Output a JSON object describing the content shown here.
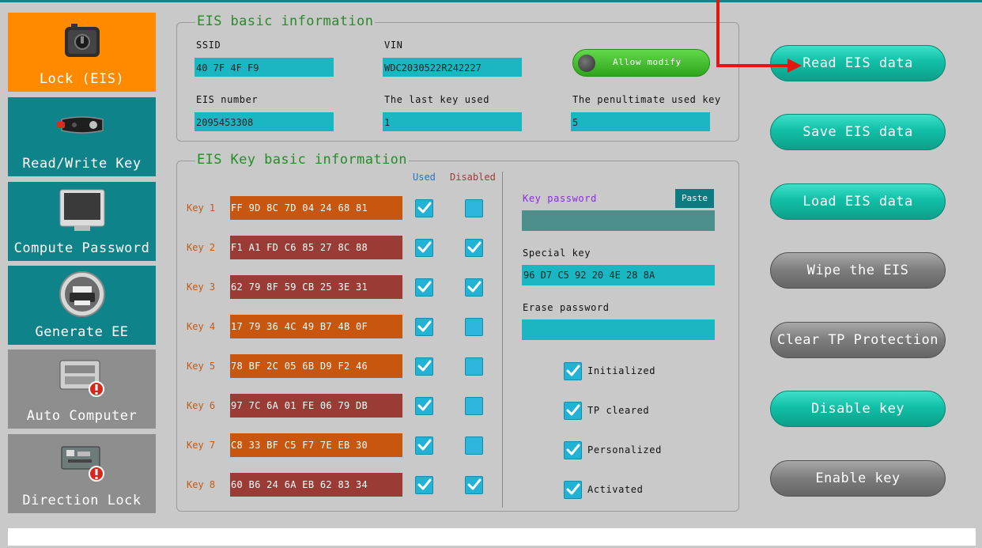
{
  "sidebar": {
    "items": [
      {
        "label": "Lock (EIS)",
        "icon": "lock-device-icon"
      },
      {
        "label": "Read/Write Key",
        "icon": "car-key-icon"
      },
      {
        "label": "Compute Password",
        "icon": "computer-monitor-icon"
      },
      {
        "label": "Generate EE",
        "icon": "printer-icon"
      },
      {
        "label": "Auto Computer",
        "icon": "ecu-warning-icon"
      },
      {
        "label": "Direction Lock",
        "icon": "circuit-board-warning-icon"
      }
    ]
  },
  "eis_basic": {
    "title": "EIS basic information",
    "ssid_label": "SSID",
    "ssid_value": "40 7F 4F F9",
    "vin_label": "VIN",
    "vin_value": "WDC2030522R242227",
    "allow_modify": "Allow modify",
    "eis_number_label": "EIS number",
    "eis_number_value": "2095453308",
    "last_key_label": "The last key used",
    "last_key_value": "1",
    "penultimate_label": "The penultimate used key",
    "penultimate_value": "5"
  },
  "eis_keys": {
    "title": "EIS Key basic information",
    "used_header": "Used",
    "disabled_header": "Disabled",
    "keys": [
      {
        "label": "Key 1",
        "value": "FF 9D 8C 7D 04 24 68 81",
        "used": true,
        "disabled": false
      },
      {
        "label": "Key 2",
        "value": "F1 A1 FD C6 85 27 8C 88",
        "used": true,
        "disabled": true
      },
      {
        "label": "Key 3",
        "value": "62 79 8F 59 CB 25 3E 31",
        "used": true,
        "disabled": true
      },
      {
        "label": "Key 4",
        "value": "17 79 36 4C 49 B7 4B 0F",
        "used": true,
        "disabled": false
      },
      {
        "label": "Key 5",
        "value": "78 BF 2C 05 6B D9 F2 46",
        "used": true,
        "disabled": false
      },
      {
        "label": "Key 6",
        "value": "97 7C 6A 01 FE 06 79 DB",
        "used": true,
        "disabled": false
      },
      {
        "label": "Key 7",
        "value": "C8 33 BF C5 F7 7E EB 30",
        "used": true,
        "disabled": false
      },
      {
        "label": "Key 8",
        "value": "60 B6 24 6A EB 62 83 34",
        "used": true,
        "disabled": true
      }
    ],
    "key_password_label": "Key password",
    "paste_label": "Paste",
    "special_key_label": "Special key",
    "special_key_value": "96 D7 C5 92 20 4E 28 8A",
    "erase_password_label": "Erase password",
    "status": [
      {
        "label": "Initialized",
        "checked": true
      },
      {
        "label": "TP cleared",
        "checked": true
      },
      {
        "label": "Personalized",
        "checked": true
      },
      {
        "label": "Activated",
        "checked": true
      }
    ]
  },
  "actions": {
    "read": "Read  EIS data",
    "save": "Save EIS data",
    "load": "Load EIS data",
    "wipe": "Wipe the EIS",
    "clear_tp": "Clear TP Protection",
    "disable_key": "Disable key",
    "enable_key": "Enable key"
  },
  "colors": {
    "accent_teal": "#0e848a",
    "active_orange": "#ff8a00",
    "field_cyan": "#1ab7c2",
    "arrow_red": "#e8140f"
  }
}
